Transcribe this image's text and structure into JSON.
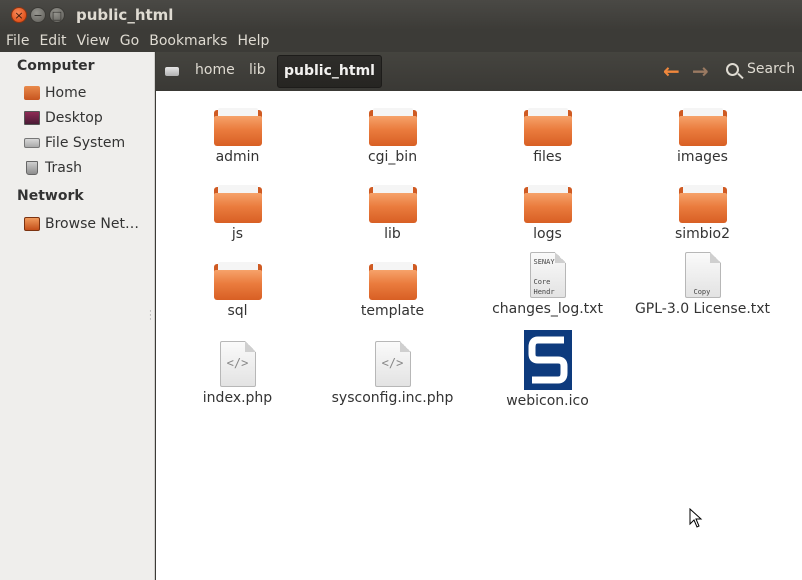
{
  "window": {
    "title": "public_html"
  },
  "menubar": [
    "File",
    "Edit",
    "View",
    "Go",
    "Bookmarks",
    "Help"
  ],
  "sidebar": {
    "computer_heading": "Computer",
    "computer_items": [
      {
        "label": "Home",
        "icon": "home-icon"
      },
      {
        "label": "Desktop",
        "icon": "desktop-icon"
      },
      {
        "label": "File System",
        "icon": "drive-icon"
      },
      {
        "label": "Trash",
        "icon": "trash-icon"
      }
    ],
    "network_heading": "Network",
    "network_items": [
      {
        "label": "Browse Net…",
        "icon": "network-icon"
      }
    ]
  },
  "toolbar": {
    "breadcrumbs": [
      "home",
      "lib",
      "public_html"
    ],
    "active_crumb": "public_html",
    "search_label": "Search"
  },
  "files": [
    {
      "name": "admin",
      "type": "folder"
    },
    {
      "name": "cgi_bin",
      "type": "folder"
    },
    {
      "name": "files",
      "type": "folder"
    },
    {
      "name": "images",
      "type": "folder"
    },
    {
      "name": "js",
      "type": "folder"
    },
    {
      "name": "lib",
      "type": "folder"
    },
    {
      "name": "logs",
      "type": "folder"
    },
    {
      "name": "simbio2",
      "type": "folder"
    },
    {
      "name": "sql",
      "type": "folder"
    },
    {
      "name": "template",
      "type": "folder"
    },
    {
      "name": "changes_log.txt",
      "type": "text",
      "preview": "SENAY\n\nCore\nHendr"
    },
    {
      "name": "GPL-3.0 License.txt",
      "type": "text",
      "preview": "\n\n\nCopy"
    },
    {
      "name": "index.php",
      "type": "code"
    },
    {
      "name": "sysconfig.inc.php",
      "type": "code"
    },
    {
      "name": "webicon.ico",
      "type": "image"
    }
  ],
  "colors": {
    "folder_orange": "#ea7c3e",
    "nav_arrow": "#f0873c",
    "webicon_blue": "#0d3a7d"
  }
}
